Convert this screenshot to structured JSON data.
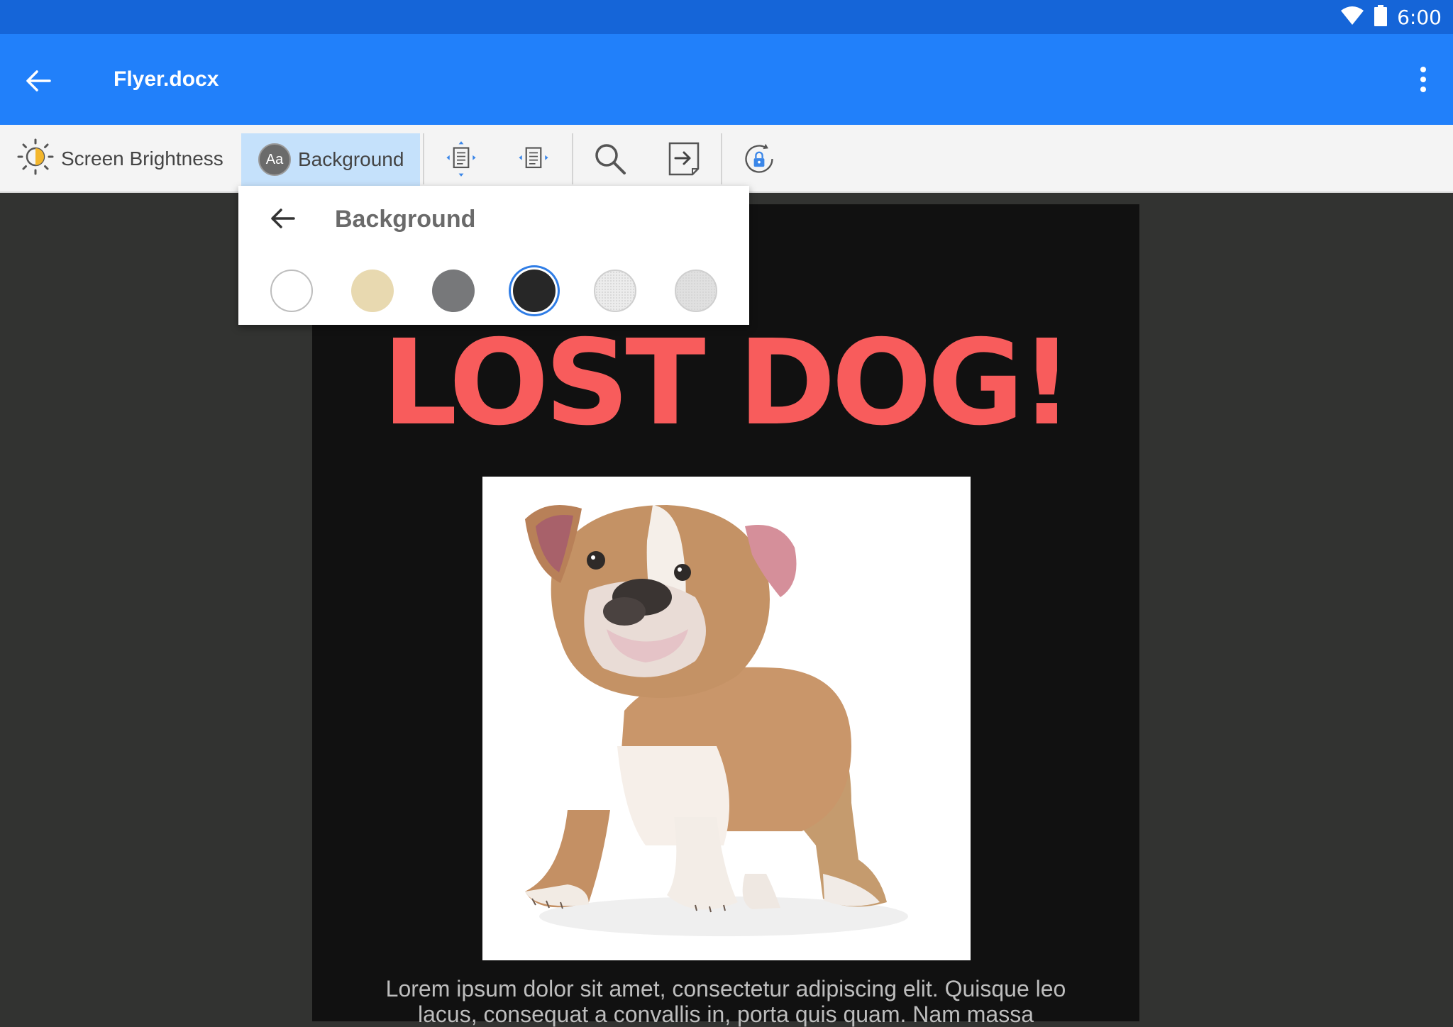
{
  "status_bar": {
    "time": "6:00"
  },
  "app_bar": {
    "title": "Flyer.docx"
  },
  "toolbar": {
    "brightness_label": "Screen Brightness",
    "background_label": "Background",
    "background_badge": "Aa"
  },
  "popup": {
    "title": "Background",
    "swatches": [
      {
        "name": "white",
        "color": "#ffffff",
        "selected": false
      },
      {
        "name": "sepia",
        "color": "#e8d9b0",
        "selected": false
      },
      {
        "name": "gray",
        "color": "#77787a",
        "selected": false
      },
      {
        "name": "black",
        "color": "#272727",
        "selected": true
      },
      {
        "name": "light-texture",
        "color": "#ececec",
        "selected": false
      },
      {
        "name": "paper-texture",
        "color": "#e0e0e0",
        "selected": false
      }
    ]
  },
  "document": {
    "headline": "LOST DOG!",
    "photo_icon": "bulldog-puppy-photo",
    "body_line1": "Lorem ipsum dolor sit amet, consectetur adipiscing elit. Quisque leo",
    "body_line2": "lacus, consequat a convallis in, porta quis quam. Nam massa"
  },
  "colors": {
    "status_bar": "#1565d8",
    "app_bar": "#2180fa",
    "headline": "#f85c5c",
    "page": "#111111",
    "workspace": "#323331"
  }
}
